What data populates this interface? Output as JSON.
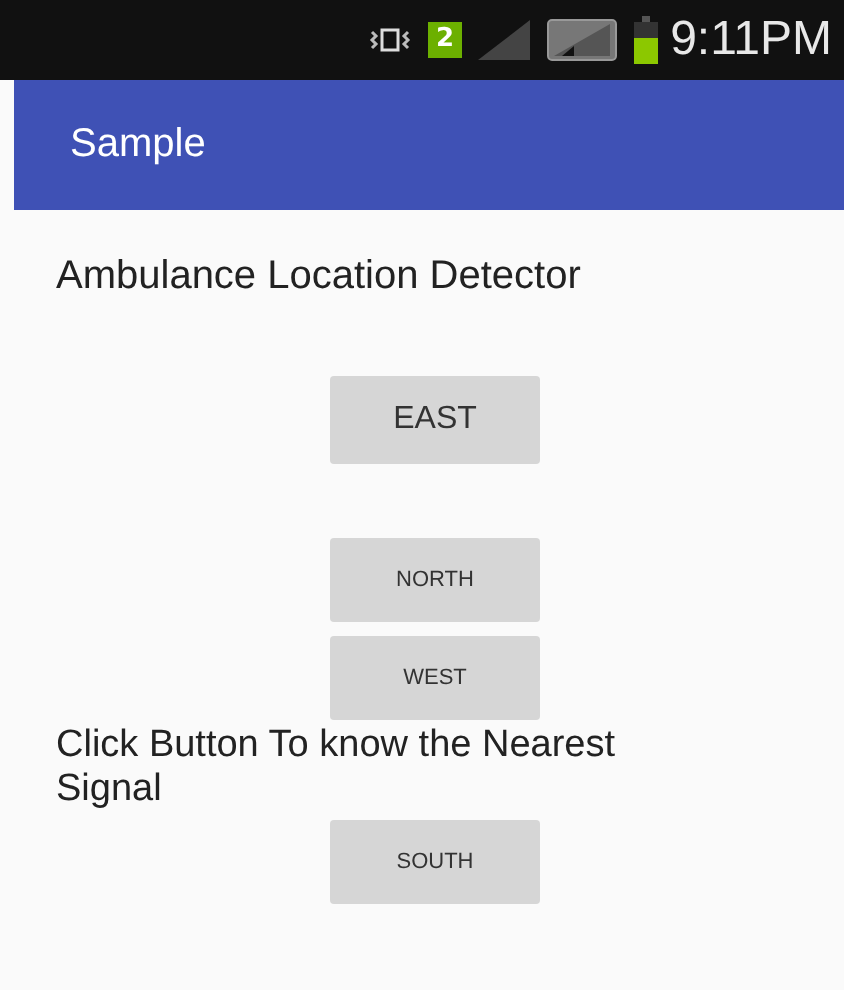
{
  "status_bar": {
    "sim_badge": "2",
    "time": "9:11PM"
  },
  "app_bar": {
    "title": "Sample"
  },
  "heading": "Ambulance Location Detector",
  "buttons": [
    {
      "label": "EAST",
      "kind": "large"
    },
    {
      "label": "NORTH",
      "kind": "small"
    },
    {
      "label": "WEST",
      "kind": "small"
    }
  ],
  "instruction": "Click Button To know the Nearest Signal",
  "last_button": {
    "label": "SOUTH",
    "kind": "small"
  }
}
